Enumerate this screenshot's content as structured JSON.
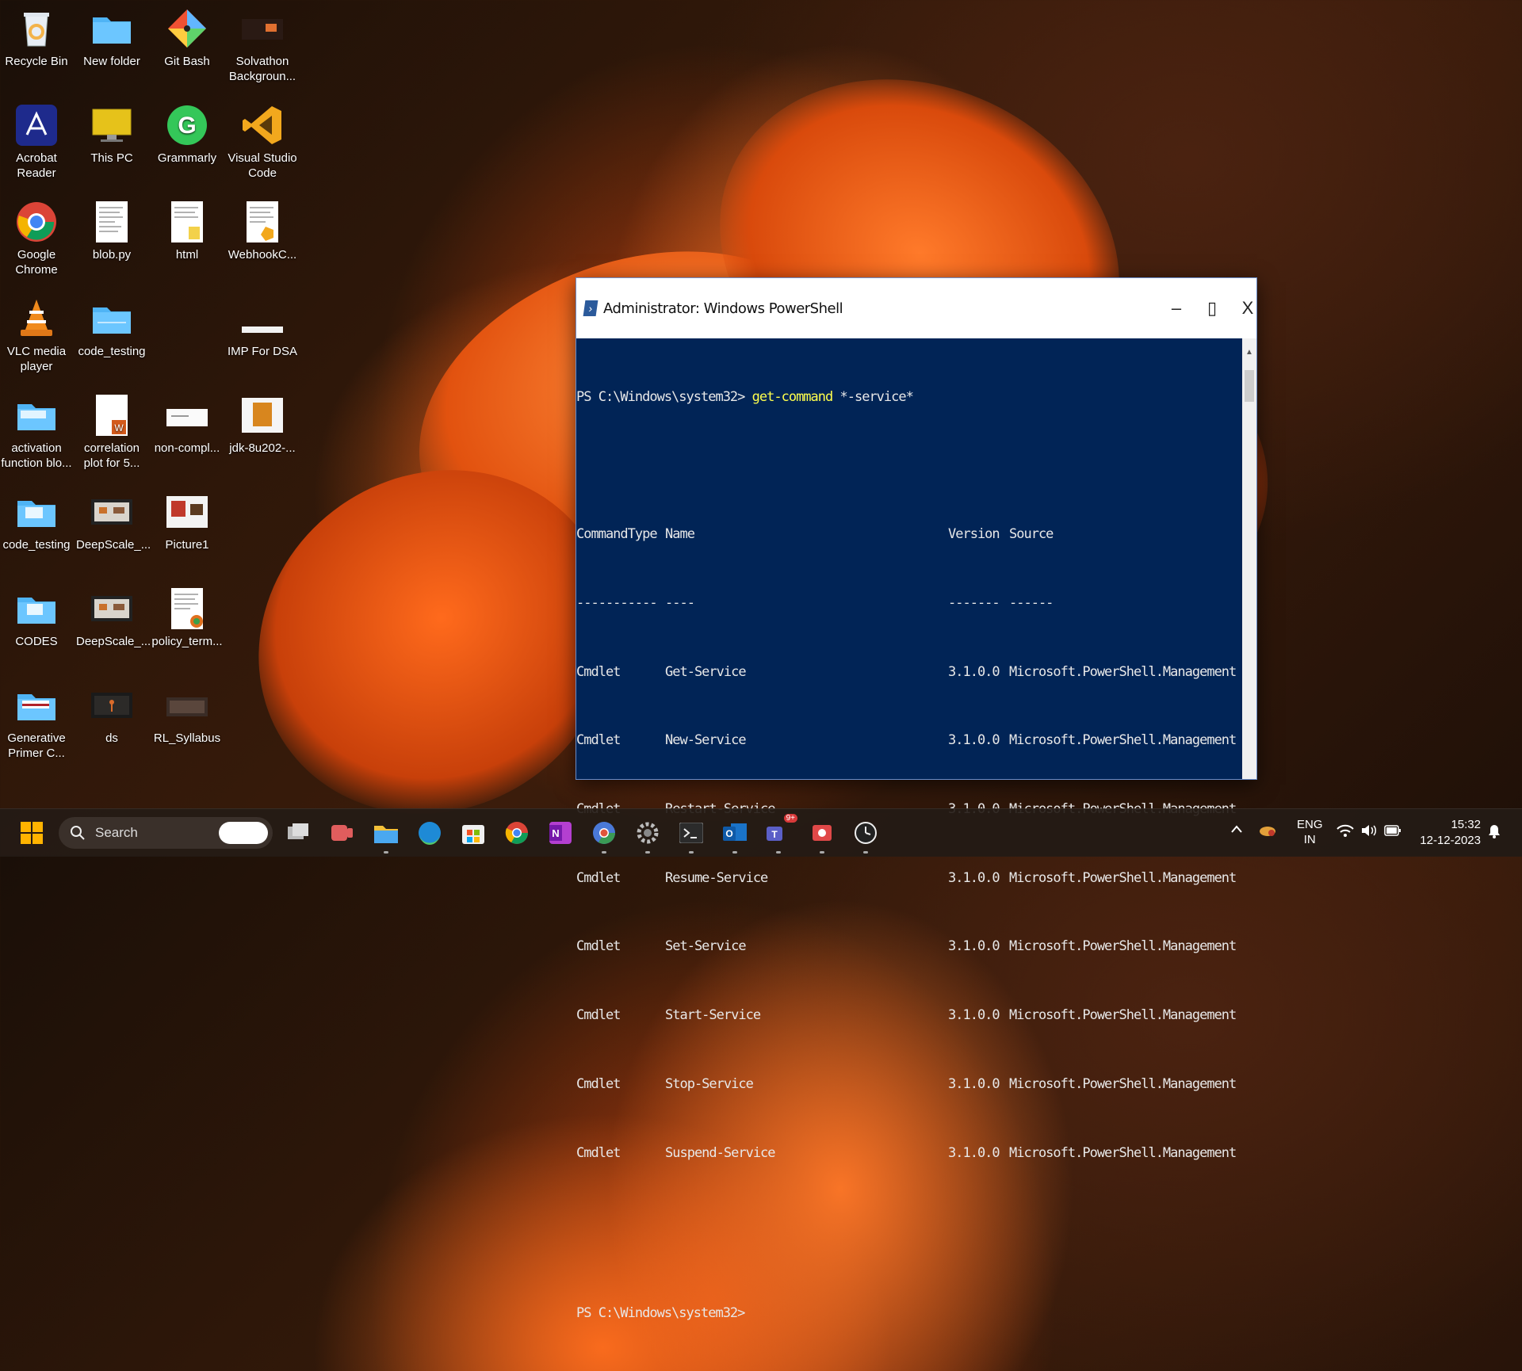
{
  "desktop_icons": [
    {
      "label": "Recycle Bin",
      "icon": "recycle-bin-icon"
    },
    {
      "label": "New folder",
      "icon": "folder-icon"
    },
    {
      "label": "Git Bash",
      "icon": "git-bash-icon"
    },
    {
      "label": "Solvathon Backgroun...",
      "icon": "image-file-icon"
    },
    {
      "label": "Acrobat Reader",
      "icon": "acrobat-icon"
    },
    {
      "label": "This PC",
      "icon": "this-pc-icon"
    },
    {
      "label": "Grammarly",
      "icon": "grammarly-icon"
    },
    {
      "label": "Visual Studio Code",
      "icon": "vscode-icon"
    },
    {
      "label": "Google Chrome",
      "icon": "chrome-icon"
    },
    {
      "label": "blob.py",
      "icon": "python-file-icon"
    },
    {
      "label": "html",
      "icon": "text-file-icon"
    },
    {
      "label": "WebhookC...",
      "icon": "vscode-file-icon"
    },
    {
      "label": "VLC media player",
      "icon": "vlc-icon"
    },
    {
      "label": "code_testing",
      "icon": "folder-icon"
    },
    {
      "label": "IMP For DSA",
      "icon": "image-file-icon"
    },
    {
      "label": "activation function blo...",
      "icon": "folder-icon"
    },
    {
      "label": "correlation plot for 5...",
      "icon": "word-file-icon"
    },
    {
      "label": "non-compl...",
      "icon": "image-file-icon"
    },
    {
      "label": "jdk-8u202-...",
      "icon": "installer-icon"
    },
    {
      "label": "code_testing",
      "icon": "folder-icon"
    },
    {
      "label": "DeepScale_...",
      "icon": "video-file-icon"
    },
    {
      "label": "Picture1",
      "icon": "image-file-icon"
    },
    {
      "label": "CODES",
      "icon": "folder-icon"
    },
    {
      "label": "DeepScale_...",
      "icon": "video-file-icon"
    },
    {
      "label": "policy_term...",
      "icon": "document-file-icon"
    },
    {
      "label": "Generative Primer C...",
      "icon": "folder-icon"
    },
    {
      "label": "ds",
      "icon": "video-file-icon"
    },
    {
      "label": "RL_Syllabus",
      "icon": "image-file-icon"
    }
  ],
  "window": {
    "title": "Administrator: Windows PowerShell",
    "minimize": "–",
    "maximize": "▯",
    "close": "X",
    "prompt": "PS C:\\Windows\\system32>",
    "command": "get-command",
    "argument": "*-service*",
    "headers": [
      "CommandType",
      "Name",
      "Version",
      "Source"
    ],
    "separators": [
      "-----------",
      "----",
      "-------",
      "------"
    ],
    "rows": [
      [
        "Cmdlet",
        "Get-Service",
        "3.1.0.0",
        "Microsoft.PowerShell.Management"
      ],
      [
        "Cmdlet",
        "New-Service",
        "3.1.0.0",
        "Microsoft.PowerShell.Management"
      ],
      [
        "Cmdlet",
        "Restart-Service",
        "3.1.0.0",
        "Microsoft.PowerShell.Management"
      ],
      [
        "Cmdlet",
        "Resume-Service",
        "3.1.0.0",
        "Microsoft.PowerShell.Management"
      ],
      [
        "Cmdlet",
        "Set-Service",
        "3.1.0.0",
        "Microsoft.PowerShell.Management"
      ],
      [
        "Cmdlet",
        "Start-Service",
        "3.1.0.0",
        "Microsoft.PowerShell.Management"
      ],
      [
        "Cmdlet",
        "Stop-Service",
        "3.1.0.0",
        "Microsoft.PowerShell.Management"
      ],
      [
        "Cmdlet",
        "Suspend-Service",
        "3.1.0.0",
        "Microsoft.PowerShell.Management"
      ]
    ],
    "final_prompt": "PS C:\\Windows\\system32>"
  },
  "taskbar": {
    "search_placeholder": "Search",
    "apps": [
      "start-icon",
      "task-view-icon",
      "teams-icon",
      "file-explorer-icon",
      "edge-icon",
      "store-icon",
      "chrome-icon",
      "onenote-icon",
      "chrome-dev-icon",
      "settings-icon",
      "terminal-icon",
      "outlook-icon",
      "teams-new-icon",
      "snipping-tool-icon",
      "clock-icon"
    ],
    "teams_badge": "9+",
    "lang_top": "ENG",
    "lang_bottom": "IN",
    "time": "15:32",
    "date": "12-12-2023"
  },
  "colors": {
    "console_bg": "#012456",
    "console_text": "#e8e8e8",
    "command_yellow": "#ffff4d",
    "taskbar_bg": "#241b16"
  }
}
